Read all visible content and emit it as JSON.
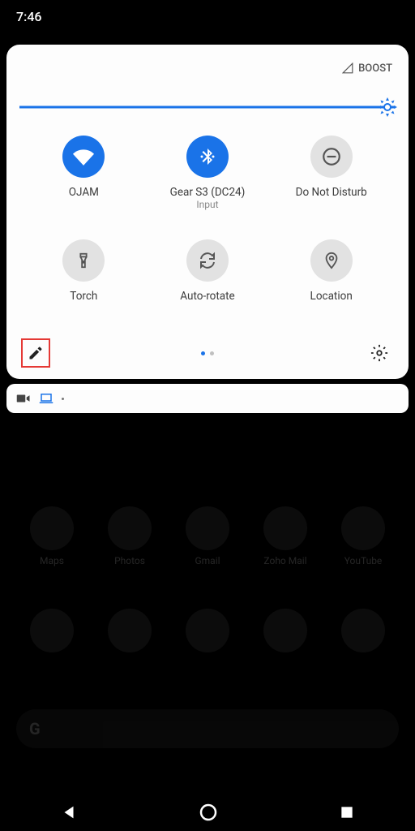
{
  "status": {
    "time": "7:46"
  },
  "qs": {
    "carrier": "",
    "boost_label": "BOOST",
    "brightness_pct": 100,
    "tiles": [
      {
        "label": "OJAM",
        "sublabel": "",
        "active": true
      },
      {
        "label": "Gear S3 (DC24)",
        "sublabel": "Input",
        "active": true
      },
      {
        "label": "Do Not Disturb",
        "sublabel": "",
        "active": false
      },
      {
        "label": "Torch",
        "sublabel": "",
        "active": false
      },
      {
        "label": "Auto-rotate",
        "sublabel": "",
        "active": false
      },
      {
        "label": "Location",
        "sublabel": "",
        "active": false
      }
    ]
  },
  "apps": {
    "row1": [
      "Maps",
      "Photos",
      "Gmail",
      "Zoho Mail",
      "YouTube"
    ]
  },
  "colors": {
    "accent": "#1a73e8",
    "inactive": "#e2e2e2"
  }
}
